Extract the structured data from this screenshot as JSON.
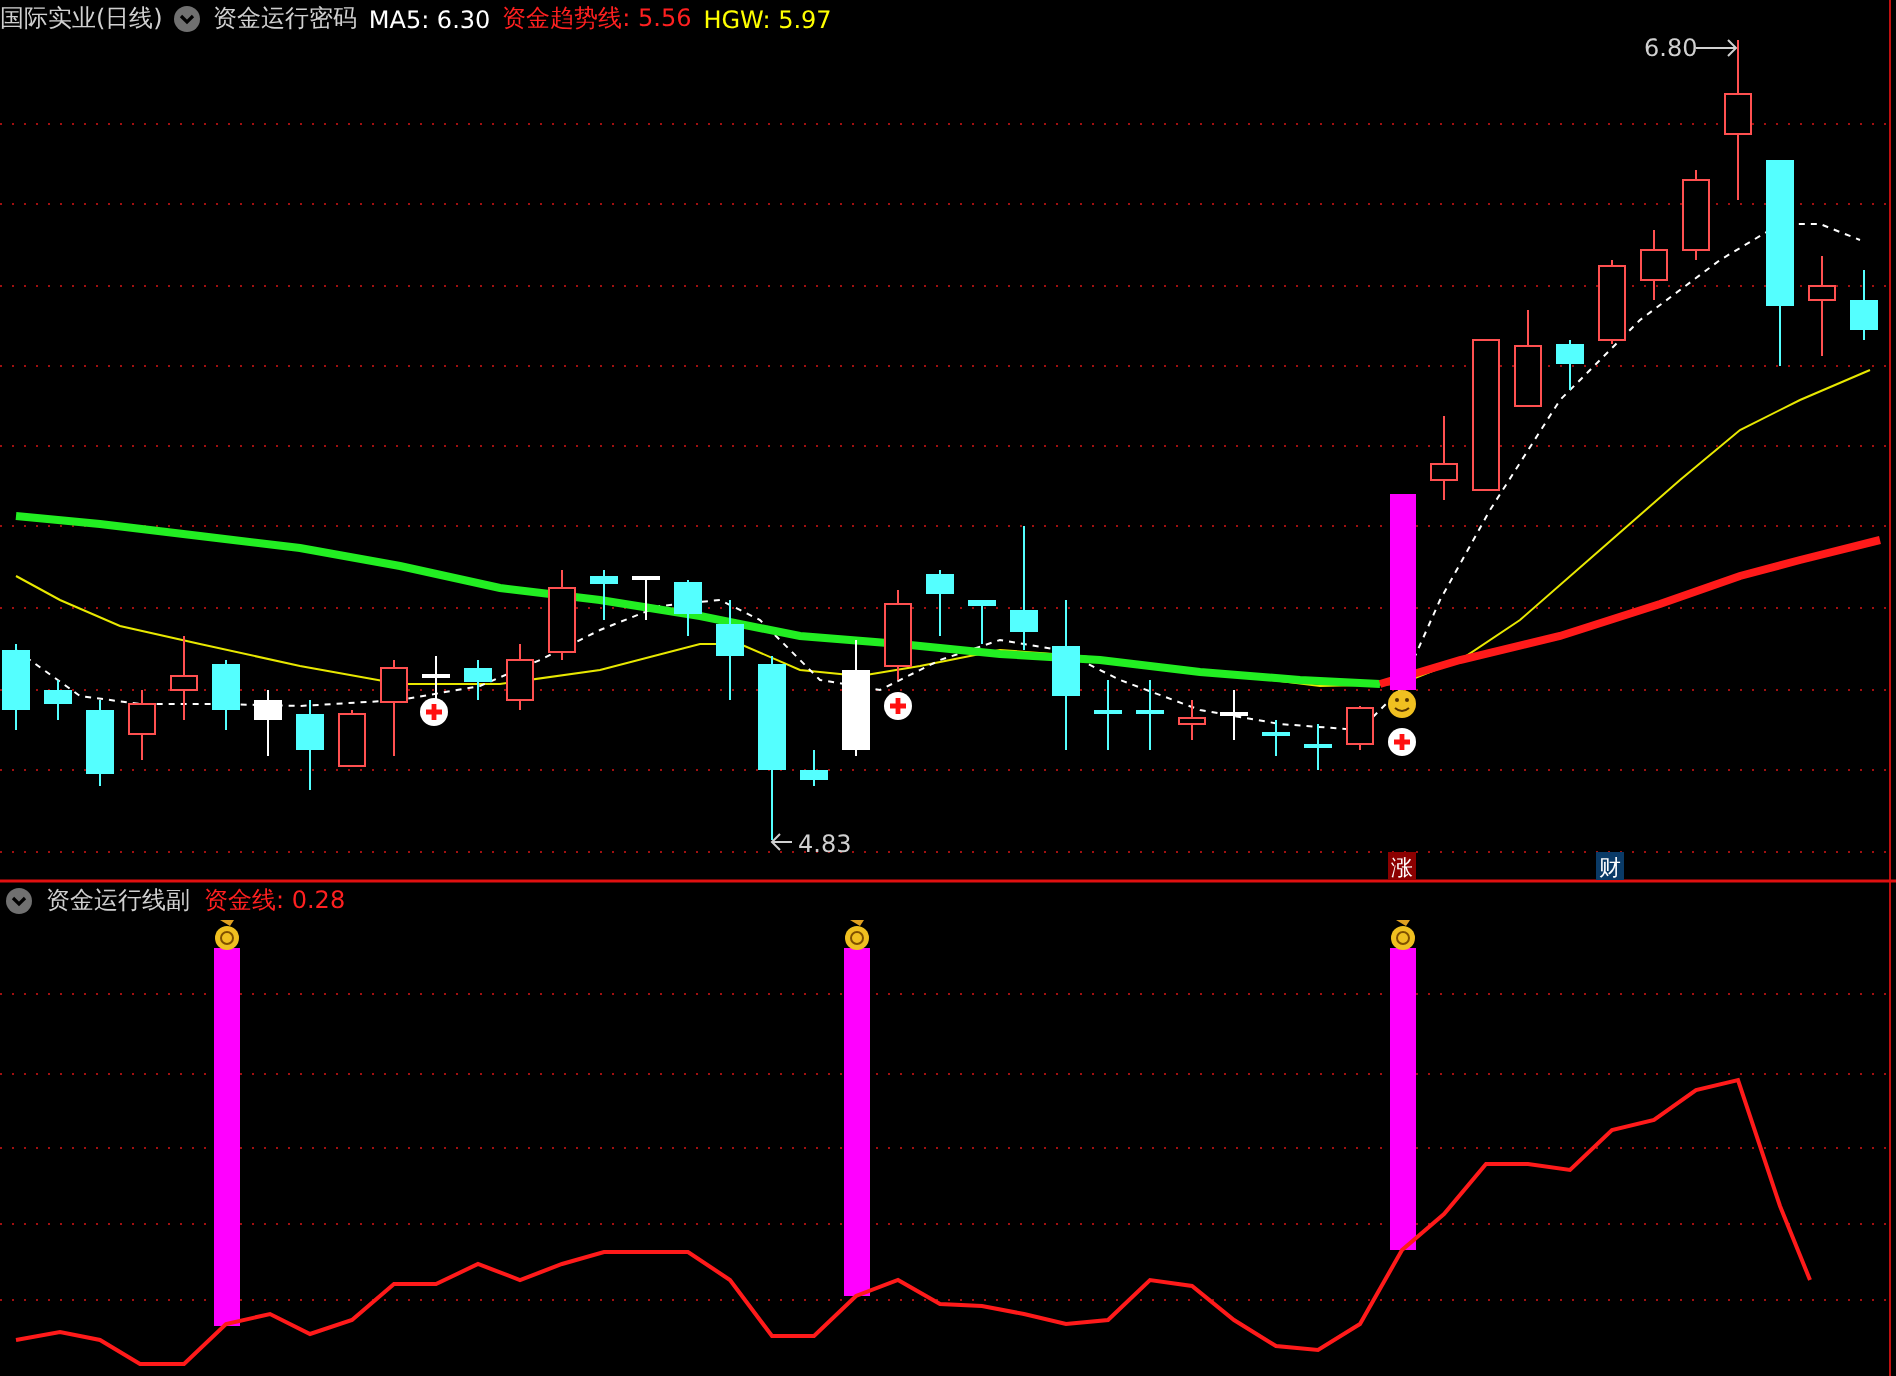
{
  "main_panel": {
    "stock_name": "国际实业(日线)",
    "indicator_name": "资金运行密码",
    "legend": [
      {
        "label": "MA5: 6.30",
        "color": "#ffffff"
      },
      {
        "label": "资金趋势线: 5.56",
        "color": "#ff2020"
      },
      {
        "label": "HGW: 5.97",
        "color": "#ffff00"
      }
    ],
    "high_label": "6.80",
    "low_label": "4.83",
    "signal_badges": [
      {
        "text": "涨",
        "color": "#8b0000"
      },
      {
        "text": "财",
        "color": "#0a3a66"
      }
    ]
  },
  "sub_panel": {
    "indicator_name": "资金运行线副",
    "value_label": "资金线: 0.28"
  }
}
